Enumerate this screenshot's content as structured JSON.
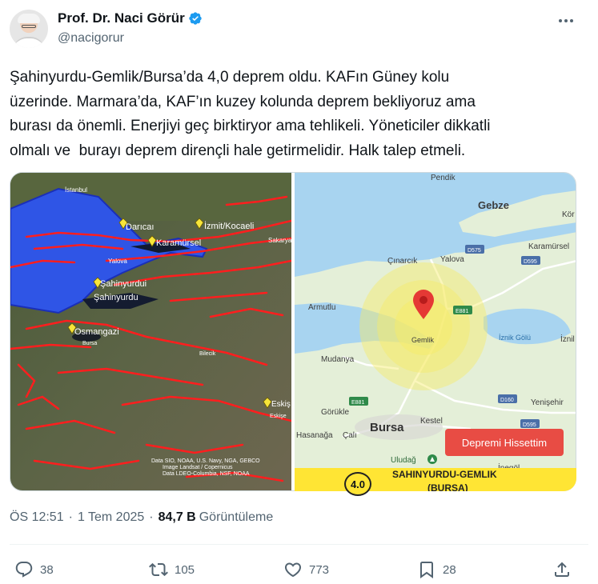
{
  "author": {
    "name": "Prof. Dr. Naci Görür",
    "handle": "@nacigorur"
  },
  "tweet_text": "Şahinyurdu-Gemlik/Bursa’da 4,0 deprem oldu. KAFın Güney kolu\nüzerinde. Marmara’da, KAF’ın kuzey kolunda deprem bekliyoruz ama\nburası da önemli. Enerjiyi geç birktiryor ama tehlikeli. Yöneticiler dikkatli\nolmalı ve  burayı deprem dirençli hale getirmelidir. Halk talep etmeli.",
  "satellite_map": {
    "labels": [
      "İstanbul",
      "Darıcaı",
      "İzmit/Kocaeli",
      "Karamürsel",
      "Yalova",
      "Sakarya",
      "Şahinyurdui",
      "Şahinyurdu",
      "Osmangazi",
      "Bursa",
      "Bilecik",
      "Eskiş",
      "Eskişe"
    ],
    "attribution": [
      "Data SIO, NOAA, U.S. Navy, NGA, GEBCO",
      "Image Landsat / Copernicus",
      "Data LDEO-Columbia, NSF, NOAA"
    ]
  },
  "quake_map": {
    "labels": [
      "Pendik",
      "Gebze",
      "Kör",
      "Karamürsel",
      "Çınarcık",
      "Yalova",
      "Armutlu",
      "Gemlik",
      "İznik Gölü",
      "İznil",
      "Mudanya",
      "Görükle",
      "Yenişehir",
      "Bursa",
      "Kestel",
      "Hasanağa",
      "Çalı",
      "Uludağ",
      "İnegöl"
    ],
    "road_labels": [
      "D575",
      "D595",
      "E881",
      "E881",
      "D160",
      "D595"
    ],
    "alert_button": "Depremi Hissettim",
    "magnitude": "4.0",
    "location_title": "SAHINYURDU-GEMLIK",
    "location_sub": "(BURSA)",
    "colors": {
      "alert": "#e84c44",
      "bar": "#ffe534",
      "pin": "#e53935",
      "water": "#a8d4f0"
    }
  },
  "meta": {
    "time": "ÖS 12:51",
    "sep1": "·",
    "date": "1 Tem 2025",
    "sep2": "·",
    "views": "84,7 B",
    "views_label": "Görüntüleme"
  },
  "actions": {
    "replies": "38",
    "reposts": "105",
    "likes": "773",
    "bookmarks": "28"
  },
  "icons": [
    "verified-badge-icon",
    "more-icon",
    "reply-icon",
    "repost-icon",
    "like-icon",
    "bookmark-icon",
    "share-icon",
    "map-pin-icon",
    "uludag-icon"
  ]
}
